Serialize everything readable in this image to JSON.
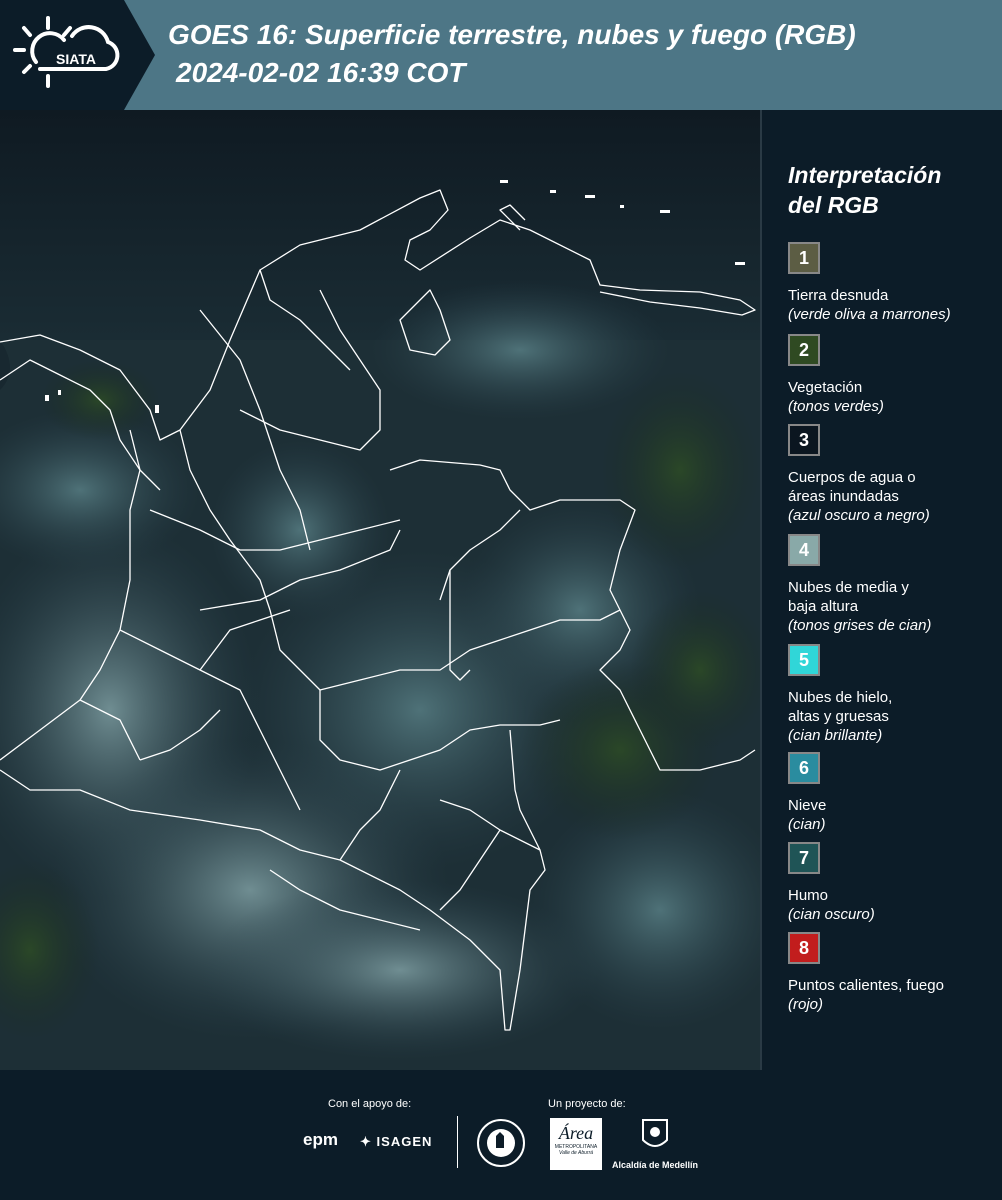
{
  "header": {
    "logo_text": "SIATA",
    "title_line1": "GOES 16: Superficie terrestre, nubes y fuego (RGB)",
    "title_line2": "2024-02-02 16:39 COT"
  },
  "legend": {
    "title": "Interpretación del RGB",
    "items": [
      {
        "number": "1",
        "label": "Tierra desnuda",
        "sub": "(verde oliva a marrones)",
        "color": "#5c5d44"
      },
      {
        "number": "2",
        "label": "Vegetación",
        "sub": "(tonos verdes)",
        "color": "#2f4a22"
      },
      {
        "number": "3",
        "label": "Cuerpos de agua o\náreas inundadas",
        "sub": "(azul oscuro a negro)",
        "color": "#0b1620"
      },
      {
        "number": "4",
        "label": "Nubes de media y\nbaja altura",
        "sub": "(tonos grises de cian)",
        "color": "#89a9a8"
      },
      {
        "number": "5",
        "label": "Nubes de hielo,\naltas y gruesas",
        "sub": "(cian brillante)",
        "color": "#30d6d8"
      },
      {
        "number": "6",
        "label": "Nieve",
        "sub": "(cian)",
        "color": "#2a8c9f"
      },
      {
        "number": "7",
        "label": "Humo",
        "sub": "(cian oscuro)",
        "color": "#1f5456"
      },
      {
        "number": "8",
        "label": "Puntos calientes, fuego",
        "sub": "(rojo)",
        "color": "#c21d1d"
      }
    ]
  },
  "footer": {
    "support_caption": "Con el apoyo de:",
    "project_caption": "Un proyecto de:",
    "epm": "epm",
    "isagen": "ISAGEN",
    "area_logo": "Área",
    "area_metro": "METROPOLITANA",
    "area_sub": "Valle de Aburrá",
    "alcaldia": "Alcaldía de Medellín"
  }
}
